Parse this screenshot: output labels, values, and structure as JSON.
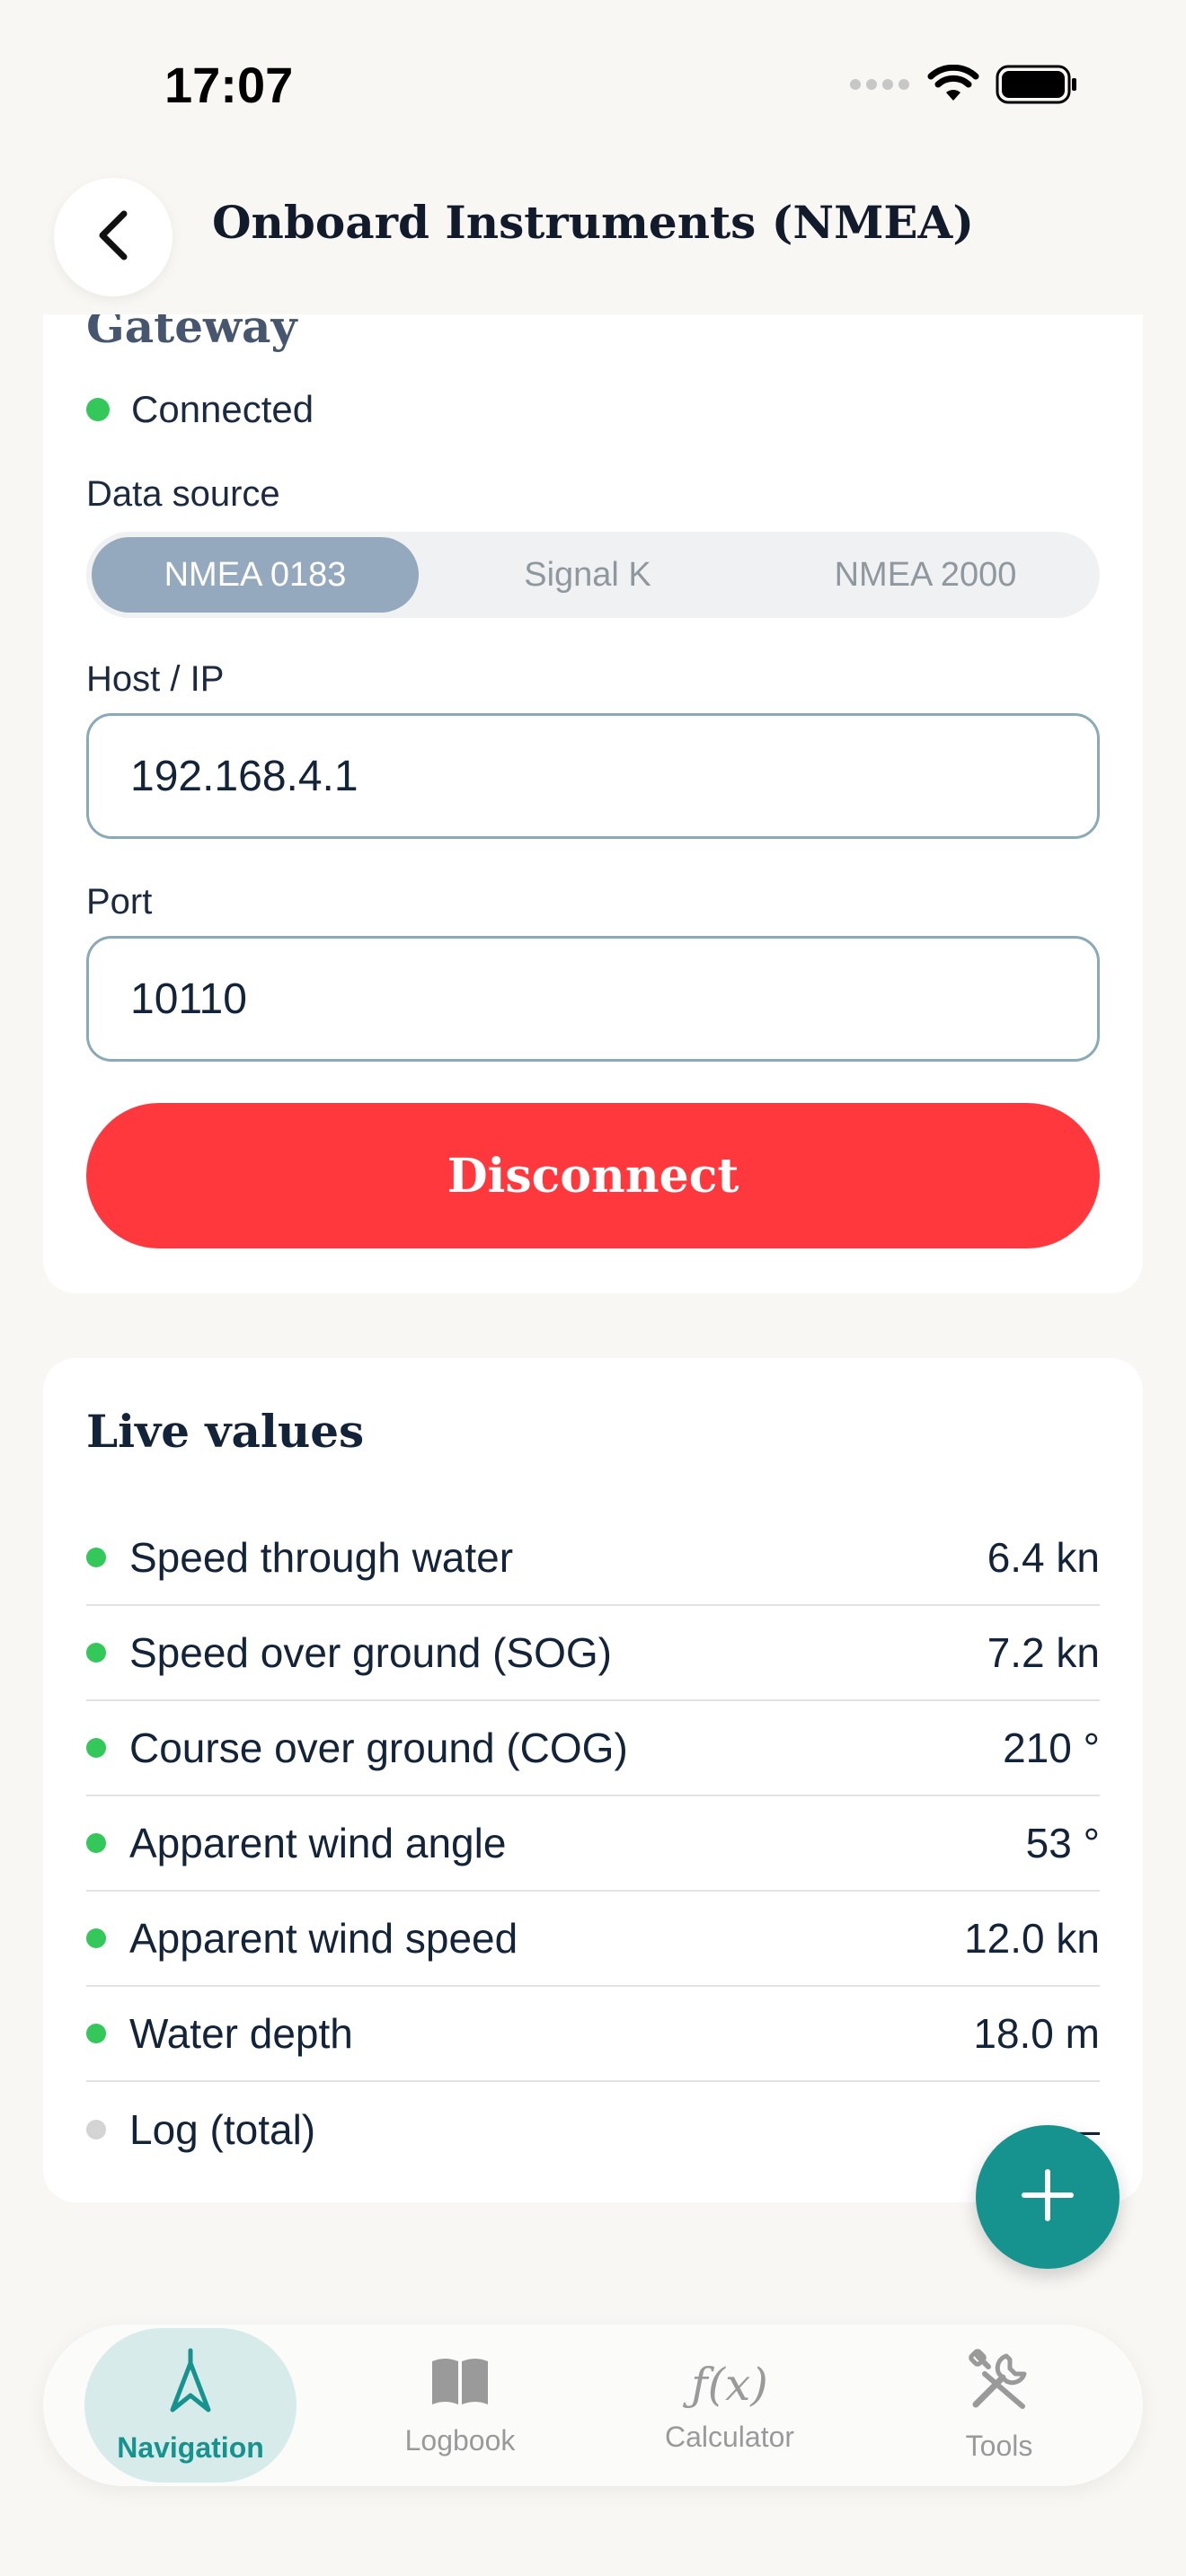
{
  "status_bar": {
    "time": "17:07"
  },
  "header": {
    "title": "Onboard Instruments (NMEA)"
  },
  "gateway": {
    "title": "Gateway",
    "status": "Connected",
    "data_source_label": "Data source",
    "data_source_options": [
      "NMEA 0183",
      "Signal K",
      "NMEA 2000"
    ],
    "data_source_selected": "NMEA 0183",
    "host_label": "Host / IP",
    "host_value": "192.168.4.1",
    "port_label": "Port",
    "port_value": "10110",
    "disconnect_label": "Disconnect"
  },
  "live_values": {
    "title": "Live values",
    "rows": [
      {
        "label": "Speed through water",
        "value": "6.4 kn",
        "active": true
      },
      {
        "label": "Speed over ground (SOG)",
        "value": "7.2 kn",
        "active": true
      },
      {
        "label": "Course over ground (COG)",
        "value": "210 °",
        "active": true
      },
      {
        "label": "Apparent wind angle",
        "value": "53 °",
        "active": true
      },
      {
        "label": "Apparent wind speed",
        "value": "12.0 kn",
        "active": true
      },
      {
        "label": "Water depth",
        "value": "18.0 m",
        "active": true
      },
      {
        "label": "Log (total)",
        "value": "—",
        "active": false
      }
    ]
  },
  "fab": {
    "icon": "plus-icon"
  },
  "tabbar": {
    "items": [
      {
        "label": "Navigation",
        "icon": "navigation-icon",
        "active": true
      },
      {
        "label": "Logbook",
        "icon": "book-icon",
        "active": false
      },
      {
        "label": "Calculator",
        "icon": "function-icon",
        "active": false
      },
      {
        "label": "Tools",
        "icon": "tools-icon",
        "active": false
      }
    ]
  },
  "colors": {
    "accent": "#16938e",
    "danger": "#fe383d",
    "connected": "#34c759",
    "segment_active": "#94a9bd"
  }
}
